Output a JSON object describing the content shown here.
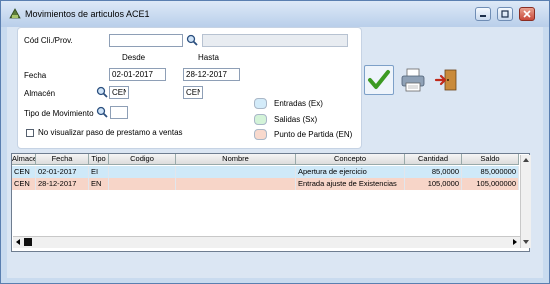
{
  "window": {
    "title": "Movimientos de articulos ACE1"
  },
  "form": {
    "cod_label": "Cód Cli./Prov.",
    "cod_value": "",
    "cod_name_value": "",
    "desde_label": "Desde",
    "hasta_label": "Hasta",
    "fecha_label": "Fecha",
    "fecha_desde": "02-01-2017",
    "fecha_hasta": "28-12-2017",
    "almacen_label": "Almacén",
    "almacen_desde": "CEN",
    "almacen_hasta": "CEN",
    "tipo_label": "Tipo de Movimiento",
    "tipo_value": "",
    "no_visualizar_label": "No visualizar paso de prestamo a ventas"
  },
  "legend": {
    "entradas": {
      "label": "Entradas (Ex)",
      "color": "#d3ebf9"
    },
    "salidas": {
      "label": "Salidas  (Sx)",
      "color": "#d3f3d8"
    },
    "punto": {
      "label": "Punto de Partida (EN)",
      "color": "#f8d9cd"
    }
  },
  "grid": {
    "columns": [
      "Almacen",
      "Fecha",
      "Tipo",
      "Codigo",
      "Nombre",
      "Concepto",
      "Cantidad",
      "Saldo"
    ],
    "rows": [
      {
        "almacen": "CEN",
        "fecha": "02-01-2017",
        "tipo": "EI",
        "codigo": "",
        "nombre": "",
        "concepto": "Apertura de ejercicio",
        "cantidad": "85,0000",
        "saldo": "85,000000",
        "kind": "entrada"
      },
      {
        "almacen": "CEN",
        "fecha": "28-12-2017",
        "tipo": "EN",
        "codigo": "",
        "nombre": "",
        "concepto": "Entrada ajuste de Existencias",
        "cantidad": "105,0000",
        "saldo": "105,000000",
        "kind": "punto"
      }
    ]
  }
}
